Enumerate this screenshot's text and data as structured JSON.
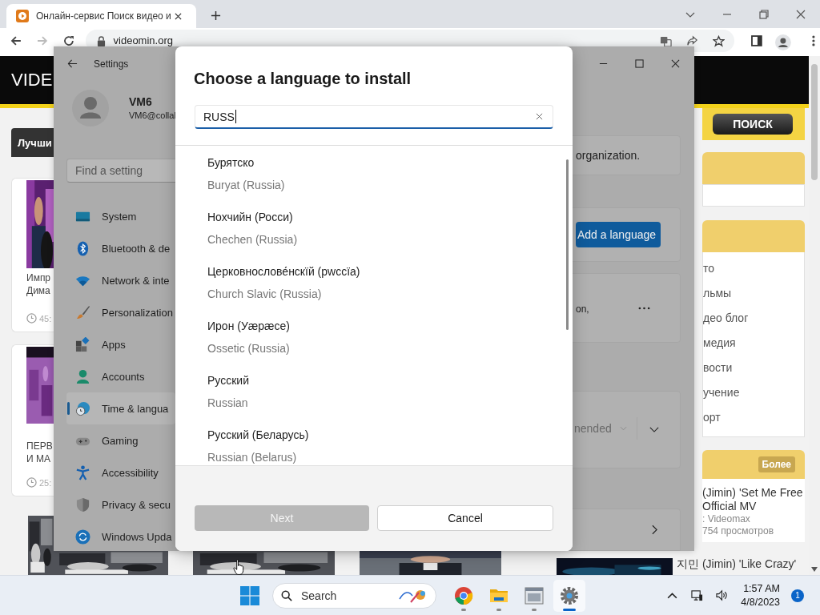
{
  "browser": {
    "tab_title": "Онлайн-сервис Поиск видео и",
    "address": "videomin.org",
    "nav_buttons": [
      {
        "kind": "back",
        "disabled": false
      },
      {
        "kind": "forward",
        "disabled": true
      },
      {
        "kind": "reload",
        "disabled": false
      }
    ]
  },
  "web_page": {
    "logo": "VIDE",
    "left_heading": "Лучши",
    "cards": [
      {
        "lines": [
          "Импр",
          "Дима"
        ],
        "duration": "45:"
      },
      {
        "lines": [
          "ПЕРВ",
          "И МА"
        ],
        "duration": "25:"
      }
    ],
    "search_button": "ПОИСК",
    "menu": [
      "то",
      "льмы",
      "део блог",
      "медия",
      "вости",
      "учение",
      "орт"
    ],
    "more_button": "Более",
    "video": {
      "title_lines": [
        "(Jimin) 'Set Me Free",
        "Official MV"
      ],
      "channel": ": Videomax",
      "views": "754 просмотров"
    },
    "bottom_video_title": "지민 (Jimin) 'Like Crazy'"
  },
  "settings": {
    "title": "Settings",
    "user_name": "VM6",
    "user_email": "VM6@collal",
    "search_placeholder": "Find a setting",
    "nav": [
      {
        "kind": "system",
        "label": "System",
        "selected": false
      },
      {
        "kind": "bluetooth",
        "label": "Bluetooth & de",
        "selected": false
      },
      {
        "kind": "network",
        "label": "Network & inte",
        "selected": false
      },
      {
        "kind": "personalization",
        "label": "Personalization",
        "selected": false
      },
      {
        "kind": "apps",
        "label": "Apps",
        "selected": false
      },
      {
        "kind": "accounts",
        "label": "Accounts",
        "selected": false
      },
      {
        "kind": "time",
        "label": "Time & langua",
        "selected": true
      },
      {
        "kind": "gaming",
        "label": "Gaming",
        "selected": false
      },
      {
        "kind": "accessibility",
        "label": "Accessibility",
        "selected": false
      },
      {
        "kind": "privacy",
        "label": "Privacy & secu",
        "selected": false
      },
      {
        "kind": "update",
        "label": "Windows Upda",
        "selected": false
      }
    ],
    "note": "organization.",
    "add_button": "Add a language",
    "language_detail": "on,",
    "dropdown_value": "nended"
  },
  "dialog": {
    "title": "Choose a language to install",
    "search_value": "RUSS",
    "languages": [
      {
        "native": "Бурятско",
        "english": "Buryat (Russia)"
      },
      {
        "native": "Нохчийн (Росси)",
        "english": "Chechen (Russia)"
      },
      {
        "native": "Церковнослове́нскїй (рwссїа)",
        "english": "Church Slavic (Russia)"
      },
      {
        "native": "Ирон (Уæрæсе)",
        "english": "Ossetic (Russia)"
      },
      {
        "native": "Русский",
        "english": "Russian"
      },
      {
        "native": "Русский (Беларусь)",
        "english": "Russian (Belarus)"
      }
    ],
    "next": {
      "label": "Next",
      "disabled": true
    },
    "cancel": "Cancel"
  },
  "taskbar": {
    "search_placeholder": "Search",
    "apps": [
      {
        "kind": "chrome",
        "active": false
      },
      {
        "kind": "folder",
        "active": false
      },
      {
        "kind": "window",
        "active": false
      },
      {
        "kind": "settings",
        "active": true
      }
    ],
    "time": "1:57 AM",
    "date": "4/8/2023",
    "notifications": "1"
  }
}
